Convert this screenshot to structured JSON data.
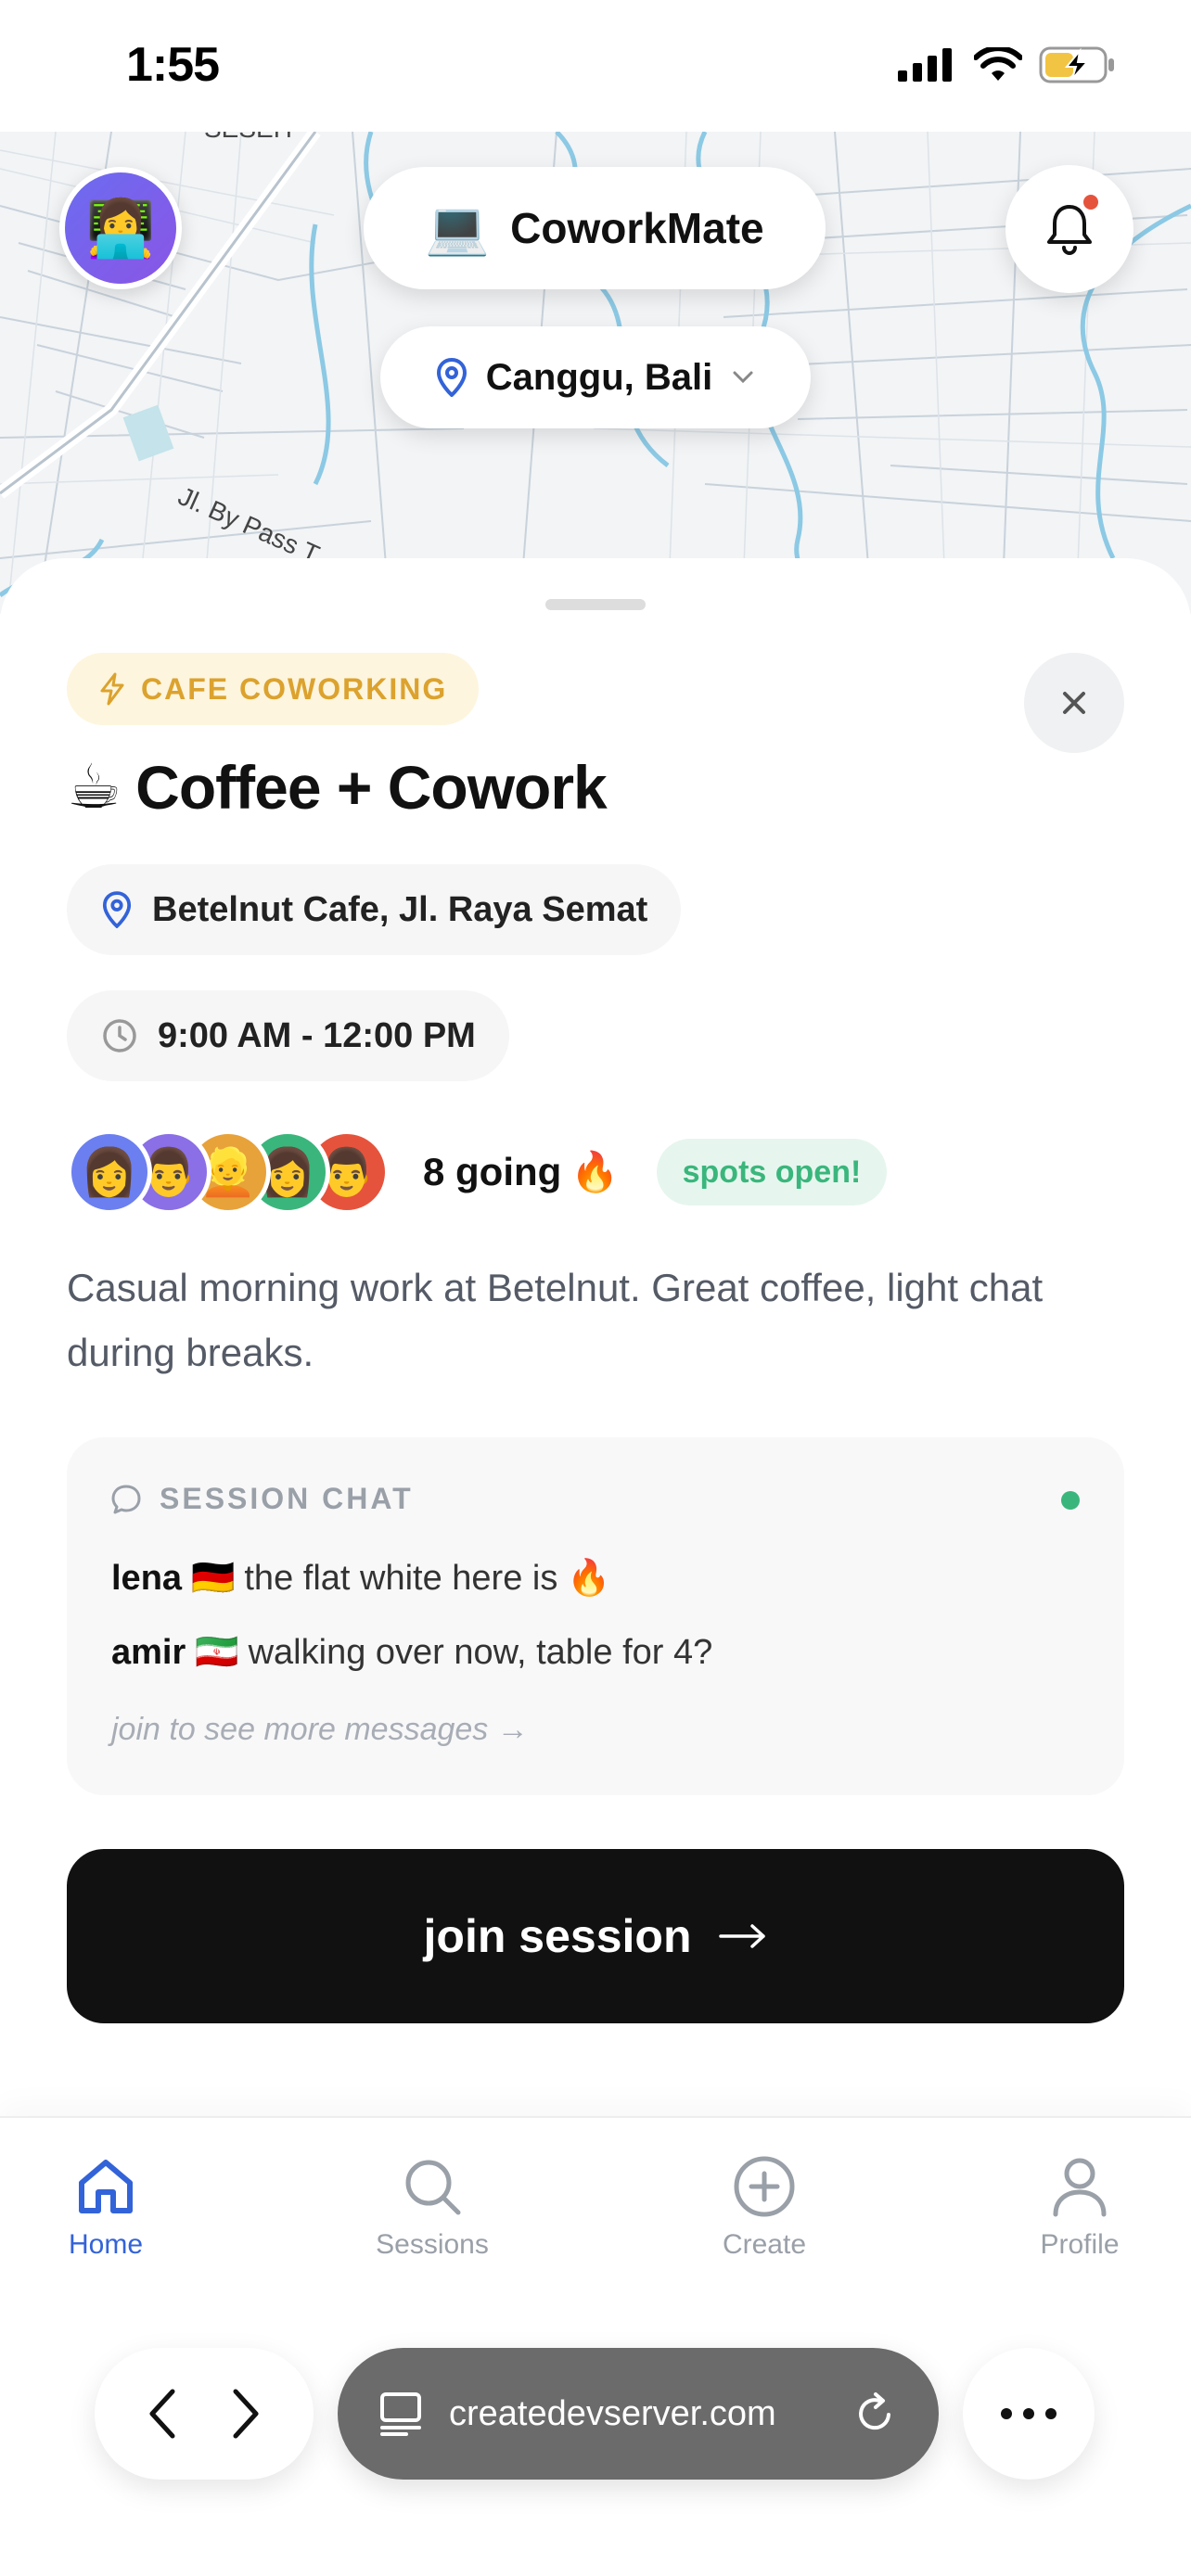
{
  "status_bar": {
    "time": "1:55"
  },
  "header": {
    "avatar_emoji": "👩‍💻",
    "brand_emoji": "💻",
    "brand": "CoworkMate",
    "location": "Canggu, Bali",
    "notification_dot_color": "#e6533c"
  },
  "map": {
    "street_label": "Jl. By Pass T"
  },
  "session": {
    "tag": "CAFE COWORKING",
    "title_emoji": "☕",
    "title": "Coffee + Cowork",
    "location": "Betelnut Cafe, Jl. Raya Semat",
    "time": "9:00 AM - 12:00 PM",
    "attendees": [
      {
        "emoji": "👩",
        "color": "#6b7ff0"
      },
      {
        "emoji": "👨",
        "color": "#8a6fe6"
      },
      {
        "emoji": "👱",
        "color": "#e8a23a"
      },
      {
        "emoji": "👩",
        "color": "#3ab67c"
      },
      {
        "emoji": "👨",
        "color": "#e6533c"
      }
    ],
    "going": "8 going",
    "going_emoji": "🔥",
    "spots": "spots open!",
    "description": "Casual morning work at Betelnut. Great coffee, light chat during breaks."
  },
  "chat": {
    "heading": "SESSION CHAT",
    "messages": [
      {
        "user": "lena",
        "flag": "🇩🇪",
        "text": "the flat white here is",
        "emoji": "🔥"
      },
      {
        "user": "amir",
        "flag": "🇮🇷",
        "text": "walking over now, table for 4?",
        "emoji": ""
      }
    ],
    "more": "join to see more messages →"
  },
  "cta": {
    "label": "join session",
    "arrow": "→"
  },
  "tabs": [
    {
      "label": "Home",
      "active": true
    },
    {
      "label": "Sessions",
      "active": false
    },
    {
      "label": "Create",
      "active": false
    },
    {
      "label": "Profile",
      "active": false
    }
  ],
  "browser": {
    "url": "createdevserver.com"
  },
  "colors": {
    "accent": "#3363d8",
    "tag": "#dca22e",
    "success": "#3ab67c",
    "cta": "#111111"
  }
}
